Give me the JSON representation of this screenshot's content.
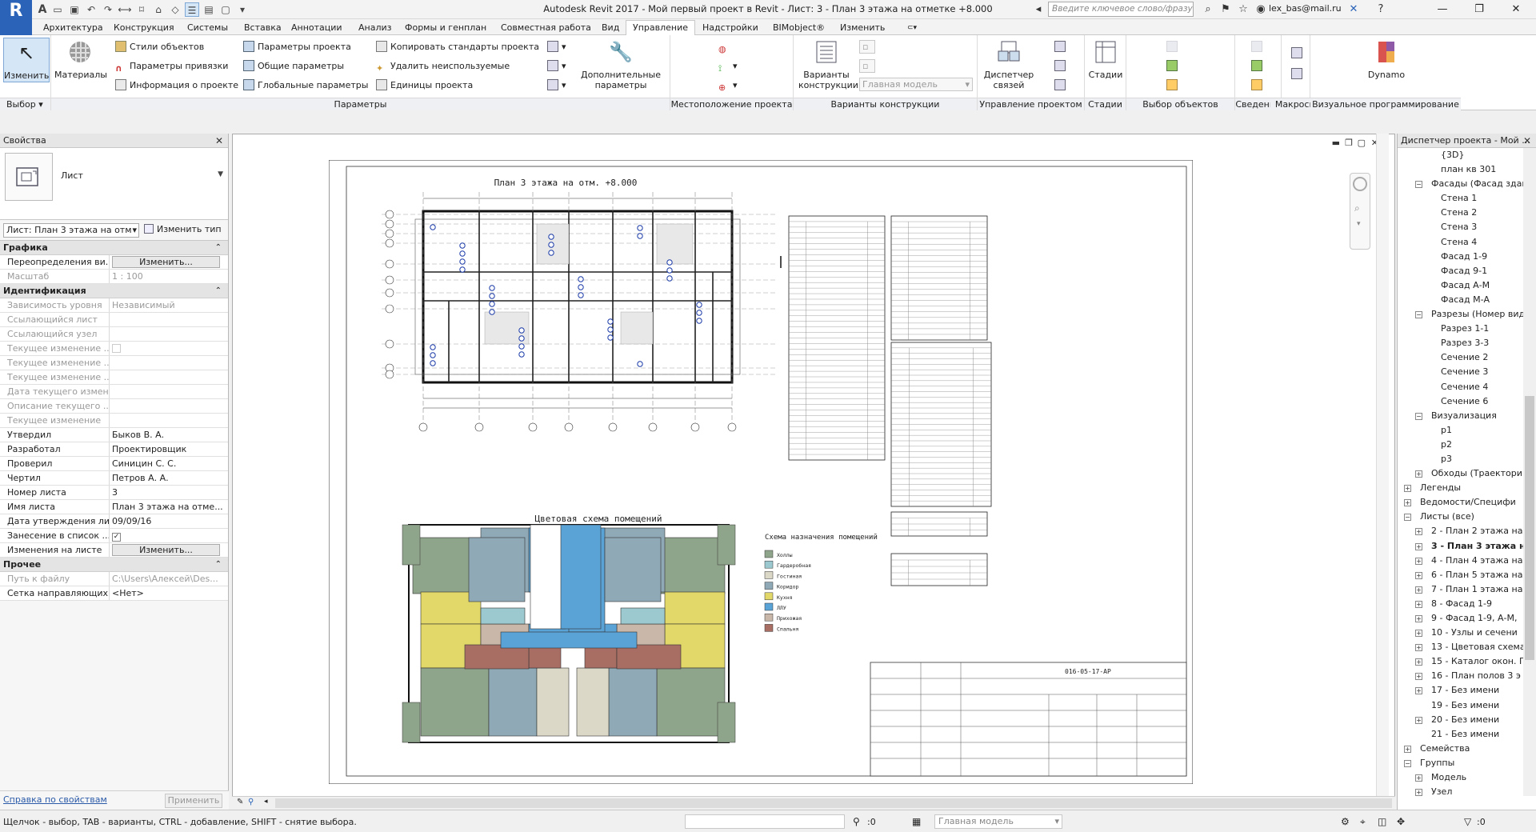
{
  "app": {
    "title": "Autodesk Revit 2017 -    Мой первый проект в Revit - Лист: 3 - План 3 этажа на отметке +8.000",
    "search_placeholder": "Введите ключевое слово/фразу",
    "user": "lex_bas@mail.ru",
    "logo": "R"
  },
  "tabs": [
    "Архитектура",
    "Конструкция",
    "Системы",
    "Вставка",
    "Аннотации",
    "Анализ",
    "Формы и генплан",
    "Совместная работа",
    "Вид",
    "Управление",
    "Надстройки",
    "BIMobject®",
    "Изменить"
  ],
  "active_tab": "Управление",
  "ribbon": {
    "select": {
      "button": "Изменить",
      "label": "Выбор"
    },
    "params": {
      "materials": "Материалы",
      "object_styles": "Стили объектов",
      "snaps": "Параметры привязки",
      "project_info": "Информация о проекте",
      "project_params": "Параметры проекта",
      "shared_params": "Общие параметры",
      "global_params": "Глобальные  параметры",
      "transfer": "Копировать стандарты проекта",
      "purge": "Удалить неиспользуемые",
      "units": "Единицы проекта",
      "additional": "Дополнительные параметры",
      "label": "Параметры"
    },
    "location": {
      "label": "Местоположение проекта"
    },
    "design_options": {
      "button": "Варианты конструкции",
      "combo": "Главная модель",
      "label": "Варианты конструкции"
    },
    "manage_project": {
      "manage_links": "Диспетчер связей",
      "label": "Управление проектом"
    },
    "phasing": {
      "button": "Стадии",
      "label": "Стадии"
    },
    "selection": {
      "label": "Выбор объектов"
    },
    "inquiry": {
      "label": "Сведения"
    },
    "macros": {
      "label": "Макросы"
    },
    "visual": {
      "button": "Dynamo",
      "label": "Визуальное программирование"
    }
  },
  "properties": {
    "title": "Свойства",
    "type_name": "Лист",
    "selector": "Лист: План 3 этажа на отме",
    "edit_type": "Изменить тип",
    "sections": [
      {
        "name": "Графика",
        "rows": [
          {
            "name": "Переопределения ви...",
            "value": "Изменить...",
            "kind": "button"
          },
          {
            "name": "Масштаб",
            "value": "1 : 100",
            "kind": "disabled"
          }
        ]
      },
      {
        "name": "Идентификация",
        "rows": [
          {
            "name": "Зависимость уровня",
            "value": "Независимый",
            "kind": "disabled"
          },
          {
            "name": "Ссылающийся лист",
            "value": "",
            "kind": "disabled"
          },
          {
            "name": "Ссылающийся узел",
            "value": "",
            "kind": "disabled"
          },
          {
            "name": "Текущее изменение ...",
            "value": "",
            "kind": "checkbox-disabled"
          },
          {
            "name": "Текущее изменение ...",
            "value": "",
            "kind": "disabled"
          },
          {
            "name": "Текущее изменение ...",
            "value": "",
            "kind": "disabled"
          },
          {
            "name": "Дата текущего измен...",
            "value": "",
            "kind": "disabled"
          },
          {
            "name": "Описание текущего ...",
            "value": "",
            "kind": "disabled"
          },
          {
            "name": "Текущее изменение",
            "value": "",
            "kind": "disabled"
          },
          {
            "name": "Утвердил",
            "value": "Быков В. А.",
            "kind": "text"
          },
          {
            "name": "Разработал",
            "value": "Проектировщик",
            "kind": "text"
          },
          {
            "name": "Проверил",
            "value": "Синицин С. С.",
            "kind": "text"
          },
          {
            "name": "Чертил",
            "value": "Петров А. А.",
            "kind": "text"
          },
          {
            "name": "Номер листа",
            "value": "3",
            "kind": "text"
          },
          {
            "name": "Имя листа",
            "value": "План 3 этажа на отме...",
            "kind": "text"
          },
          {
            "name": "Дата утверждения ли...",
            "value": "09/09/16",
            "kind": "text"
          },
          {
            "name": "Занесение в список ...",
            "value": "✓",
            "kind": "checkbox"
          },
          {
            "name": "Изменения на листе",
            "value": "Изменить...",
            "kind": "button"
          }
        ]
      },
      {
        "name": "Прочее",
        "rows": [
          {
            "name": "Путь к файлу",
            "value": "C:\\Users\\Алексей\\Des...",
            "kind": "disabled"
          },
          {
            "name": "Сетка направляющих",
            "value": "<Нет>",
            "kind": "text"
          }
        ]
      }
    ],
    "help": "Справка по свойствам",
    "apply": "Применить"
  },
  "sheet": {
    "plan_title": "План 3 этажа на отм. +8.000",
    "scheme_title": "Цветовая схема помещений",
    "legend_title": "Схема назначения помещений",
    "legend": [
      {
        "label": "Холлы",
        "color": "#8fa58b"
      },
      {
        "label": "Гардеробная",
        "color": "#9cc9cf"
      },
      {
        "label": "Гостиная",
        "color": "#dcd8c8"
      },
      {
        "label": "Коридор",
        "color": "#8fa9b6"
      },
      {
        "label": "Кухня",
        "color": "#e2d86a"
      },
      {
        "label": "ЛЛУ",
        "color": "#5aa3d6"
      },
      {
        "label": "Прихожая",
        "color": "#c9b8a9"
      },
      {
        "label": "Спальня",
        "color": "#a86e64"
      }
    ],
    "stamp_code": "016-05-17-АР"
  },
  "browser": {
    "title": "Диспетчер проекта - Мой ...",
    "items": [
      {
        "label": "{3D}",
        "depth": 3,
        "ex": ""
      },
      {
        "label": "план кв 301",
        "depth": 3,
        "ex": ""
      },
      {
        "label": "Фасады (Фасад здан",
        "depth": 2,
        "ex": "-"
      },
      {
        "label": "Стена 1",
        "depth": 3,
        "ex": ""
      },
      {
        "label": "Стена 2",
        "depth": 3,
        "ex": ""
      },
      {
        "label": "Стена 3",
        "depth": 3,
        "ex": ""
      },
      {
        "label": "Стена 4",
        "depth": 3,
        "ex": ""
      },
      {
        "label": "Фасад 1-9",
        "depth": 3,
        "ex": ""
      },
      {
        "label": "Фасад 9-1",
        "depth": 3,
        "ex": ""
      },
      {
        "label": "Фасад А-М",
        "depth": 3,
        "ex": ""
      },
      {
        "label": "Фасад М-А",
        "depth": 3,
        "ex": ""
      },
      {
        "label": "Разрезы (Номер вид",
        "depth": 2,
        "ex": "-"
      },
      {
        "label": "Разрез 1-1",
        "depth": 3,
        "ex": ""
      },
      {
        "label": "Разрез 3-3",
        "depth": 3,
        "ex": ""
      },
      {
        "label": "Сечение 2",
        "depth": 3,
        "ex": ""
      },
      {
        "label": "Сечение 3",
        "depth": 3,
        "ex": ""
      },
      {
        "label": "Сечение 4",
        "depth": 3,
        "ex": ""
      },
      {
        "label": "Сечение 6",
        "depth": 3,
        "ex": ""
      },
      {
        "label": "Визуализация",
        "depth": 2,
        "ex": "-"
      },
      {
        "label": "p1",
        "depth": 3,
        "ex": ""
      },
      {
        "label": "p2",
        "depth": 3,
        "ex": ""
      },
      {
        "label": "p3",
        "depth": 3,
        "ex": ""
      },
      {
        "label": "Обходы (Траектори",
        "depth": 2,
        "ex": "+"
      },
      {
        "label": "Легенды",
        "depth": 1,
        "ex": "+"
      },
      {
        "label": "Ведомости/Специфи",
        "depth": 1,
        "ex": "+"
      },
      {
        "label": "Листы (все)",
        "depth": 1,
        "ex": "-"
      },
      {
        "label": "2 - План 2 этажа на",
        "depth": 2,
        "ex": "+"
      },
      {
        "label": "3 - План 3 этажа на",
        "depth": 2,
        "ex": "+",
        "bold": true
      },
      {
        "label": "4 - План 4 этажа на",
        "depth": 2,
        "ex": "+"
      },
      {
        "label": "6 - План 5 этажа на",
        "depth": 2,
        "ex": "+"
      },
      {
        "label": "7 - План 1 этажа на",
        "depth": 2,
        "ex": "+"
      },
      {
        "label": "8 - Фасад 1-9",
        "depth": 2,
        "ex": "+"
      },
      {
        "label": "9 - Фасад 1-9, А-М,",
        "depth": 2,
        "ex": "+"
      },
      {
        "label": "10 - Узлы и сечени",
        "depth": 2,
        "ex": "+"
      },
      {
        "label": "13 - Цветовая схема",
        "depth": 2,
        "ex": "+"
      },
      {
        "label": "15 - Каталог окон. П",
        "depth": 2,
        "ex": "+"
      },
      {
        "label": "16 - План полов 3 э",
        "depth": 2,
        "ex": "+"
      },
      {
        "label": "17 - Без имени",
        "depth": 2,
        "ex": "+"
      },
      {
        "label": "19 - Без имени",
        "depth": 2,
        "ex": ""
      },
      {
        "label": "20 - Без имени",
        "depth": 2,
        "ex": "+"
      },
      {
        "label": "21 - Без имени",
        "depth": 2,
        "ex": ""
      },
      {
        "label": "Семейства",
        "depth": 1,
        "ex": "+"
      },
      {
        "label": "Группы",
        "depth": 1,
        "ex": "-"
      },
      {
        "label": "Модель",
        "depth": 2,
        "ex": "+"
      },
      {
        "label": "Узел",
        "depth": 2,
        "ex": "+"
      }
    ]
  },
  "status": {
    "hint": "Щелчок - выбор, TAB - варианты, CTRL - добавление, SHIFT - снятие выбора.",
    "model": "Главная модель",
    "zero1": ":0",
    "zero2": ":0"
  }
}
